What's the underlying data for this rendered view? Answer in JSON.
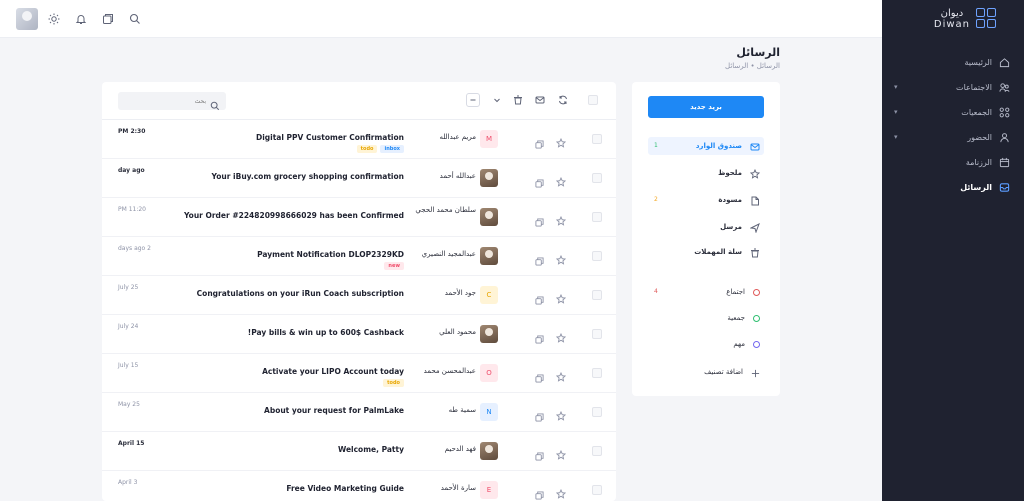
{
  "brand": {
    "name_ar": "ديوان",
    "name_en": "Diwan"
  },
  "nav": [
    {
      "label": "الرئيسية",
      "icon": "home-icon",
      "chevron": false,
      "active": false
    },
    {
      "label": "الاجتماعات",
      "icon": "meetings-icon",
      "chevron": true,
      "active": false
    },
    {
      "label": "الجمعيات",
      "icon": "associations-icon",
      "chevron": true,
      "active": false
    },
    {
      "label": "الحضور",
      "icon": "attendance-icon",
      "chevron": true,
      "active": false
    },
    {
      "label": "الرزنامة",
      "icon": "calendar-icon",
      "chevron": false,
      "active": false
    },
    {
      "label": "الرسائل",
      "icon": "messages-icon",
      "chevron": false,
      "active": true
    }
  ],
  "page": {
    "title": "الرسائل",
    "breadcrumb": "الرسائل • الرسائل"
  },
  "compose_label": "بريد جديد",
  "folders": [
    {
      "label": "صندوق الوارد",
      "icon": "inbox-icon",
      "count": "1",
      "active": true
    },
    {
      "label": "ملحوظ",
      "icon": "star-icon",
      "count": "",
      "active": false
    },
    {
      "label": "مسودة",
      "icon": "draft-icon",
      "count": "2",
      "active": false
    },
    {
      "label": "مرسل",
      "icon": "send-icon",
      "count": "",
      "active": false
    },
    {
      "label": "سلة المهملات",
      "icon": "trash-icon",
      "count": "",
      "active": false
    }
  ],
  "labels": [
    {
      "label": "اجتماع",
      "color": "#e05a5a",
      "count": "4"
    },
    {
      "label": "جمعية",
      "color": "#2fbf71",
      "count": ""
    },
    {
      "label": "مهم",
      "color": "#7367f0",
      "count": ""
    }
  ],
  "add_label": "اضافة تصنيف",
  "search": {
    "placeholder": "بحث"
  },
  "emails": [
    {
      "time": "PM 2:30",
      "time_dark": true,
      "subject": "Digital PPV Customer Confirmation",
      "tags": [
        {
          "text": "todo",
          "kind": "todo"
        },
        {
          "text": "inbox",
          "kind": "inbox"
        }
      ],
      "sender": "مريم عبدالله",
      "avatar_letter": "M",
      "avatar_color": "#ffe8ec",
      "letter_color": "#ef4d6b",
      "photo": false,
      "two_line": false
    },
    {
      "time": "day ago",
      "time_dark": true,
      "subject": "Your iBuy.com grocery shopping confirmation",
      "tags": [],
      "sender": "عبدالله أحمد",
      "avatar_letter": "",
      "avatar_color": "",
      "letter_color": "",
      "photo": true,
      "two_line": false
    },
    {
      "time": "PM 11:20",
      "time_dark": false,
      "subject": "Your Order #224820998666029 has been Confirmed",
      "tags": [],
      "sender": "سلطان محمد الحجي",
      "avatar_letter": "",
      "avatar_color": "",
      "letter_color": "",
      "photo": true,
      "two_line": true
    },
    {
      "time": "days ago 2",
      "time_dark": false,
      "subject": "Payment Notification DLOP2329KD",
      "tags": [
        {
          "text": "new",
          "kind": "new"
        }
      ],
      "sender": "عبدالمجيد النصيري",
      "avatar_letter": "",
      "avatar_color": "",
      "letter_color": "",
      "photo": true,
      "two_line": false
    },
    {
      "time": "July 25",
      "time_dark": false,
      "subject": "Congratulations on your iRun Coach subscription",
      "tags": [],
      "sender": "جود الأحمد",
      "avatar_letter": "C",
      "avatar_color": "#fff4d6",
      "letter_color": "#e8a600",
      "photo": false,
      "two_line": false
    },
    {
      "time": "July 24",
      "time_dark": false,
      "subject": "!Pay bills & win up to 600$ Cashback",
      "tags": [],
      "sender": "محمود العلي",
      "avatar_letter": "",
      "avatar_color": "",
      "letter_color": "",
      "photo": true,
      "two_line": false
    },
    {
      "time": "July 15",
      "time_dark": false,
      "subject": "Activate your LIPO Account today",
      "tags": [
        {
          "text": "todo",
          "kind": "todo"
        }
      ],
      "sender": "عبدالمحسن محمد",
      "avatar_letter": "O",
      "avatar_color": "#ffe8ec",
      "letter_color": "#ef4d6b",
      "photo": false,
      "two_line": false
    },
    {
      "time": "May 25",
      "time_dark": false,
      "subject": "About your request for PalmLake",
      "tags": [],
      "sender": "سمية طه",
      "avatar_letter": "N",
      "avatar_color": "#e6f0ff",
      "letter_color": "#1e88f5",
      "photo": false,
      "two_line": false
    },
    {
      "time": "April 15",
      "time_dark": true,
      "subject": "Welcome, Patty",
      "tags": [],
      "sender": "فهد الدحيم",
      "avatar_letter": "",
      "avatar_color": "",
      "letter_color": "",
      "photo": true,
      "two_line": false
    },
    {
      "time": "April 3",
      "time_dark": false,
      "subject": "Free Video Marketing Guide",
      "tags": [],
      "sender": "سارة الأحمد",
      "avatar_letter": "E",
      "avatar_color": "#ffe8ec",
      "letter_color": "#ef4d6b",
      "photo": false,
      "two_line": false
    }
  ]
}
